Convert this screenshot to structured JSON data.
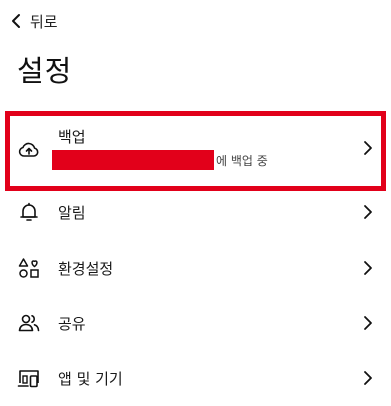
{
  "header": {
    "back_label": "뒤로"
  },
  "page": {
    "title": "설정"
  },
  "backup": {
    "title": "백업",
    "status": "에 백업 중"
  },
  "items": [
    {
      "label": "알림",
      "icon": "bell-icon"
    },
    {
      "label": "환경설정",
      "icon": "preferences-icon"
    },
    {
      "label": "공유",
      "icon": "people-icon"
    },
    {
      "label": "앱 및 기기",
      "icon": "devices-icon"
    }
  ],
  "colors": {
    "highlight": "#e2001a",
    "text": "#1a1a1a"
  }
}
